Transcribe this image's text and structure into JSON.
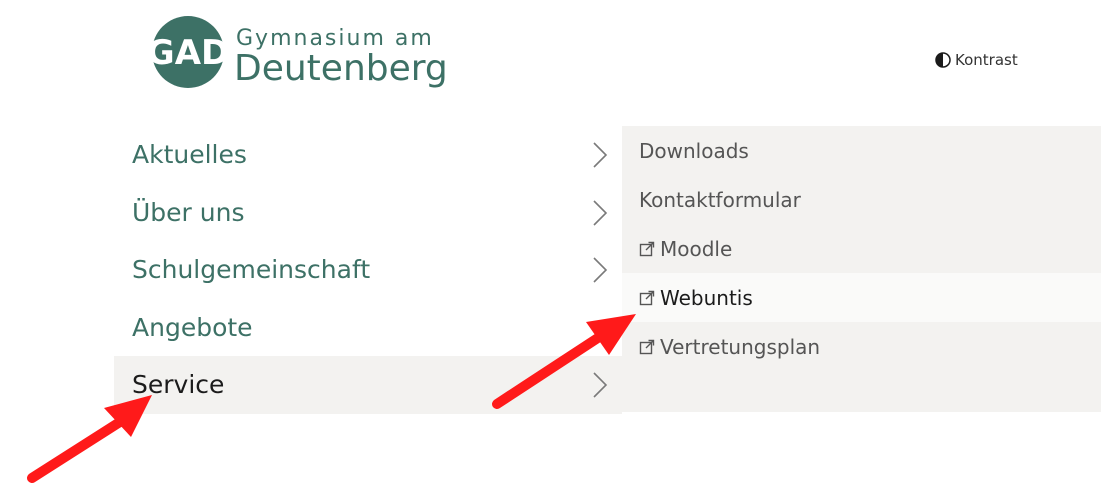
{
  "logo": {
    "line1": "Gymnasium am",
    "line2": "Deutenberg",
    "monogram": "GAD"
  },
  "header": {
    "contrast_label": "Kontrast",
    "contrast_icon": "half-circle-icon"
  },
  "menu": {
    "items": [
      {
        "label": "Aktuelles",
        "active": false
      },
      {
        "label": "Über uns",
        "active": false
      },
      {
        "label": "Schulgemeinschaft",
        "active": false
      },
      {
        "label": "Angebote",
        "active": false,
        "has_submenu": false
      },
      {
        "label": "Service",
        "active": true
      }
    ]
  },
  "submenu": {
    "items": [
      {
        "label": "Downloads",
        "external": false
      },
      {
        "label": "Kontaktformular",
        "external": false
      },
      {
        "label": "Moodle",
        "external": true
      },
      {
        "label": "Webuntis",
        "external": true,
        "active": true
      },
      {
        "label": "Vertretungsplan",
        "external": true
      }
    ]
  },
  "colors": {
    "brand": "#3d7166",
    "highlight_bg": "#f3f2f0",
    "annotation_arrow": "#ff1a1a"
  }
}
